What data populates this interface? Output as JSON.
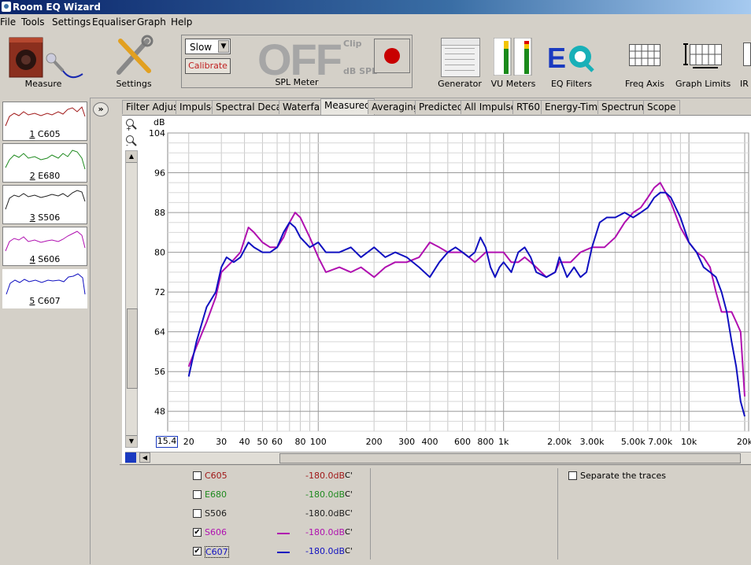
{
  "window": {
    "title": "Room EQ Wizard"
  },
  "menu": [
    "File",
    "Tools",
    "Settings",
    "Equaliser",
    "Graph",
    "Help"
  ],
  "toolbar": {
    "measure": "Measure",
    "settings": "Settings",
    "spl": {
      "mode": "Slow",
      "calibrate": "Calibrate",
      "display": "OFF",
      "clip": "Clip",
      "unit": "dB SPL",
      "label": "SPL Meter"
    },
    "generator": "Generator",
    "vu": "VU Meters",
    "eq": "EQ Filters",
    "freq_axis": "Freq Axis",
    "graph_limits": "Graph Limits",
    "ir": "IR W"
  },
  "measurements": [
    {
      "num": "1",
      "name": "C605",
      "color": "#a01818"
    },
    {
      "num": "2",
      "name": "E680",
      "color": "#1f8a1f"
    },
    {
      "num": "3",
      "name": "S506",
      "color": "#202020"
    },
    {
      "num": "4",
      "name": "S606",
      "color": "#b010b0"
    },
    {
      "num": "5",
      "name": "C607",
      "color": "#1010c0"
    }
  ],
  "tabs": [
    "Filter Adjust",
    "Impulse",
    "Spectral Decay",
    "Waterfall",
    "Measured",
    "Averaging",
    "Predicted",
    "All Impulses",
    "RT60",
    "Energy-Time",
    "Spectrum",
    "Scope"
  ],
  "active_tab": "Measured",
  "graph": {
    "y_unit": "dB",
    "x_start": "15.4"
  },
  "chart_data": {
    "type": "line",
    "title": "",
    "xlabel": "",
    "ylabel": "dB",
    "xscale": "log",
    "xlim": [
      15.4,
      21000
    ],
    "ylim": [
      44,
      104
    ],
    "y_ticks": [
      104,
      96,
      88,
      80,
      72,
      64,
      56,
      48
    ],
    "x_ticks": [
      {
        "v": 20,
        "label": "20"
      },
      {
        "v": 30,
        "label": "30"
      },
      {
        "v": 40,
        "label": "40"
      },
      {
        "v": 50,
        "label": "50"
      },
      {
        "v": 60,
        "label": "60"
      },
      {
        "v": 80,
        "label": "80"
      },
      {
        "v": 100,
        "label": "100"
      },
      {
        "v": 200,
        "label": "200"
      },
      {
        "v": 300,
        "label": "300"
      },
      {
        "v": 400,
        "label": "400"
      },
      {
        "v": 600,
        "label": "600"
      },
      {
        "v": 800,
        "label": "800"
      },
      {
        "v": 1000,
        "label": "1k"
      },
      {
        "v": 2000,
        "label": "2.00k"
      },
      {
        "v": 3000,
        "label": "3.00k"
      },
      {
        "v": 5000,
        "label": "5.00k"
      },
      {
        "v": 7000,
        "label": "7.00k"
      },
      {
        "v": 10000,
        "label": "10k"
      },
      {
        "v": 20000,
        "label": "20k"
      }
    ],
    "grid": true,
    "series": [
      {
        "name": "S606",
        "color": "#b010b0",
        "points": [
          [
            20,
            57
          ],
          [
            22,
            61
          ],
          [
            25,
            66
          ],
          [
            28,
            71
          ],
          [
            30,
            76
          ],
          [
            34,
            78
          ],
          [
            38,
            80
          ],
          [
            42,
            85
          ],
          [
            45,
            84
          ],
          [
            50,
            82
          ],
          [
            55,
            81
          ],
          [
            60,
            81
          ],
          [
            65,
            83
          ],
          [
            70,
            86
          ],
          [
            75,
            88
          ],
          [
            80,
            87
          ],
          [
            90,
            83
          ],
          [
            100,
            79
          ],
          [
            110,
            76
          ],
          [
            130,
            77
          ],
          [
            150,
            76
          ],
          [
            170,
            77
          ],
          [
            200,
            75
          ],
          [
            230,
            77
          ],
          [
            260,
            78
          ],
          [
            300,
            78
          ],
          [
            350,
            79
          ],
          [
            400,
            82
          ],
          [
            450,
            81
          ],
          [
            500,
            80
          ],
          [
            550,
            80
          ],
          [
            600,
            80
          ],
          [
            650,
            79
          ],
          [
            700,
            78
          ],
          [
            750,
            79
          ],
          [
            800,
            80
          ],
          [
            900,
            80
          ],
          [
            1000,
            80
          ],
          [
            1100,
            78
          ],
          [
            1200,
            78
          ],
          [
            1300,
            79
          ],
          [
            1400,
            78
          ],
          [
            1500,
            77
          ],
          [
            1700,
            75
          ],
          [
            1900,
            76
          ],
          [
            2000,
            78
          ],
          [
            2300,
            78
          ],
          [
            2600,
            80
          ],
          [
            3000,
            81
          ],
          [
            3500,
            81
          ],
          [
            4000,
            83
          ],
          [
            4500,
            86
          ],
          [
            5000,
            88
          ],
          [
            5500,
            89
          ],
          [
            6000,
            91
          ],
          [
            6500,
            93
          ],
          [
            7000,
            94
          ],
          [
            7500,
            92
          ],
          [
            8000,
            90
          ],
          [
            9000,
            85
          ],
          [
            10000,
            82
          ],
          [
            11000,
            80
          ],
          [
            12000,
            79
          ],
          [
            13000,
            77
          ],
          [
            14000,
            72
          ],
          [
            15000,
            68
          ],
          [
            16000,
            68
          ],
          [
            17000,
            68
          ],
          [
            18000,
            66
          ],
          [
            19000,
            64
          ],
          [
            20000,
            51
          ]
        ]
      },
      {
        "name": "C607",
        "color": "#1010c0",
        "points": [
          [
            20,
            55
          ],
          [
            22,
            62
          ],
          [
            25,
            69
          ],
          [
            28,
            72
          ],
          [
            30,
            77
          ],
          [
            32,
            79
          ],
          [
            35,
            78
          ],
          [
            38,
            79
          ],
          [
            42,
            82
          ],
          [
            45,
            81
          ],
          [
            50,
            80
          ],
          [
            55,
            80
          ],
          [
            60,
            81
          ],
          [
            65,
            84
          ],
          [
            70,
            86
          ],
          [
            75,
            85
          ],
          [
            80,
            83
          ],
          [
            90,
            81
          ],
          [
            100,
            82
          ],
          [
            110,
            80
          ],
          [
            130,
            80
          ],
          [
            150,
            81
          ],
          [
            170,
            79
          ],
          [
            200,
            81
          ],
          [
            230,
            79
          ],
          [
            260,
            80
          ],
          [
            300,
            79
          ],
          [
            350,
            77
          ],
          [
            400,
            75
          ],
          [
            450,
            78
          ],
          [
            500,
            80
          ],
          [
            550,
            81
          ],
          [
            600,
            80
          ],
          [
            650,
            79
          ],
          [
            700,
            80
          ],
          [
            750,
            83
          ],
          [
            800,
            81
          ],
          [
            850,
            77
          ],
          [
            900,
            75
          ],
          [
            950,
            77
          ],
          [
            1000,
            78
          ],
          [
            1100,
            76
          ],
          [
            1200,
            80
          ],
          [
            1300,
            81
          ],
          [
            1400,
            79
          ],
          [
            1500,
            76
          ],
          [
            1700,
            75
          ],
          [
            1900,
            76
          ],
          [
            2000,
            79
          ],
          [
            2200,
            75
          ],
          [
            2400,
            77
          ],
          [
            2600,
            75
          ],
          [
            2800,
            76
          ],
          [
            3000,
            81
          ],
          [
            3300,
            86
          ],
          [
            3600,
            87
          ],
          [
            4000,
            87
          ],
          [
            4500,
            88
          ],
          [
            5000,
            87
          ],
          [
            5500,
            88
          ],
          [
            6000,
            89
          ],
          [
            6500,
            91
          ],
          [
            7000,
            92
          ],
          [
            7500,
            92
          ],
          [
            8000,
            91
          ],
          [
            9000,
            87
          ],
          [
            10000,
            82
          ],
          [
            11000,
            80
          ],
          [
            12000,
            77
          ],
          [
            13000,
            76
          ],
          [
            14000,
            75
          ],
          [
            15000,
            72
          ],
          [
            16000,
            68
          ],
          [
            17000,
            62
          ],
          [
            18000,
            57
          ],
          [
            19000,
            50
          ],
          [
            20000,
            47
          ]
        ]
      }
    ]
  },
  "traces": [
    {
      "name": "C605",
      "value": "-180.0dB",
      "unit": "C'",
      "checked": false,
      "color": "#a01818",
      "line": false
    },
    {
      "name": "E680",
      "value": "-180.0dB",
      "unit": "C'",
      "checked": false,
      "color": "#1f8a1f",
      "line": false
    },
    {
      "name": "S506",
      "value": "-180.0dB",
      "unit": "C'",
      "checked": false,
      "color": "#202020",
      "line": false
    },
    {
      "name": "S606",
      "value": "-180.0dB",
      "unit": "C'",
      "checked": true,
      "color": "#b010b0",
      "line": true
    },
    {
      "name": "C607",
      "value": "-180.0dB",
      "unit": "C'",
      "checked": true,
      "color": "#1010c0",
      "line": true
    }
  ],
  "separate_traces": "Separate the traces"
}
